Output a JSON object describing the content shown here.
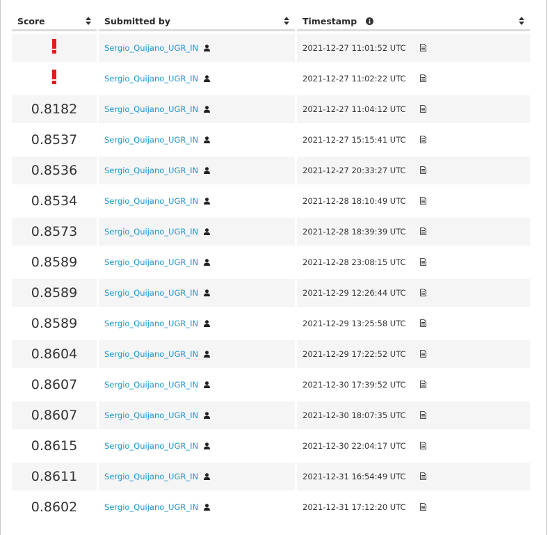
{
  "headers": {
    "score": "Score",
    "submitted_by": "Submitted by",
    "timestamp": "Timestamp"
  },
  "icons": {
    "sort": "sort-icon",
    "info": "info-icon",
    "user": "user-icon",
    "details": "file-text-icon",
    "error": "exclamation-icon"
  },
  "colors": {
    "link": "#1a96d0",
    "error": "#e41b17",
    "row_alt": "#f5f5f5"
  },
  "rows": [
    {
      "score": "",
      "error": true,
      "user": "Sergio_Quijano_UGR_IN",
      "timestamp": "2021-12-27 11:01:52 UTC"
    },
    {
      "score": "",
      "error": true,
      "user": "Sergio_Quijano_UGR_IN",
      "timestamp": "2021-12-27 11:02:22 UTC"
    },
    {
      "score": "0.8182",
      "error": false,
      "user": "Sergio_Quijano_UGR_IN",
      "timestamp": "2021-12-27 11:04:12 UTC"
    },
    {
      "score": "0.8537",
      "error": false,
      "user": "Sergio_Quijano_UGR_IN",
      "timestamp": "2021-12-27 15:15:41 UTC"
    },
    {
      "score": "0.8536",
      "error": false,
      "user": "Sergio_Quijano_UGR_IN",
      "timestamp": "2021-12-27 20:33:27 UTC"
    },
    {
      "score": "0.8534",
      "error": false,
      "user": "Sergio_Quijano_UGR_IN",
      "timestamp": "2021-12-28 18:10:49 UTC"
    },
    {
      "score": "0.8573",
      "error": false,
      "user": "Sergio_Quijano_UGR_IN",
      "timestamp": "2021-12-28 18:39:39 UTC"
    },
    {
      "score": "0.8589",
      "error": false,
      "user": "Sergio_Quijano_UGR_IN",
      "timestamp": "2021-12-28 23:08:15 UTC"
    },
    {
      "score": "0.8589",
      "error": false,
      "user": "Sergio_Quijano_UGR_IN",
      "timestamp": "2021-12-29 12:26:44 UTC"
    },
    {
      "score": "0.8589",
      "error": false,
      "user": "Sergio_Quijano_UGR_IN",
      "timestamp": "2021-12-29 13:25:58 UTC"
    },
    {
      "score": "0.8604",
      "error": false,
      "user": "Sergio_Quijano_UGR_IN",
      "timestamp": "2021-12-29 17:22:52 UTC"
    },
    {
      "score": "0.8607",
      "error": false,
      "user": "Sergio_Quijano_UGR_IN",
      "timestamp": "2021-12-30 17:39:52 UTC"
    },
    {
      "score": "0.8607",
      "error": false,
      "user": "Sergio_Quijano_UGR_IN",
      "timestamp": "2021-12-30 18:07:35 UTC"
    },
    {
      "score": "0.8615",
      "error": false,
      "user": "Sergio_Quijano_UGR_IN",
      "timestamp": "2021-12-30 22:04:17 UTC"
    },
    {
      "score": "0.8611",
      "error": false,
      "user": "Sergio_Quijano_UGR_IN",
      "timestamp": "2021-12-31 16:54:49 UTC"
    },
    {
      "score": "0.8602",
      "error": false,
      "user": "Sergio_Quijano_UGR_IN",
      "timestamp": "2021-12-31 17:12:20 UTC"
    }
  ]
}
